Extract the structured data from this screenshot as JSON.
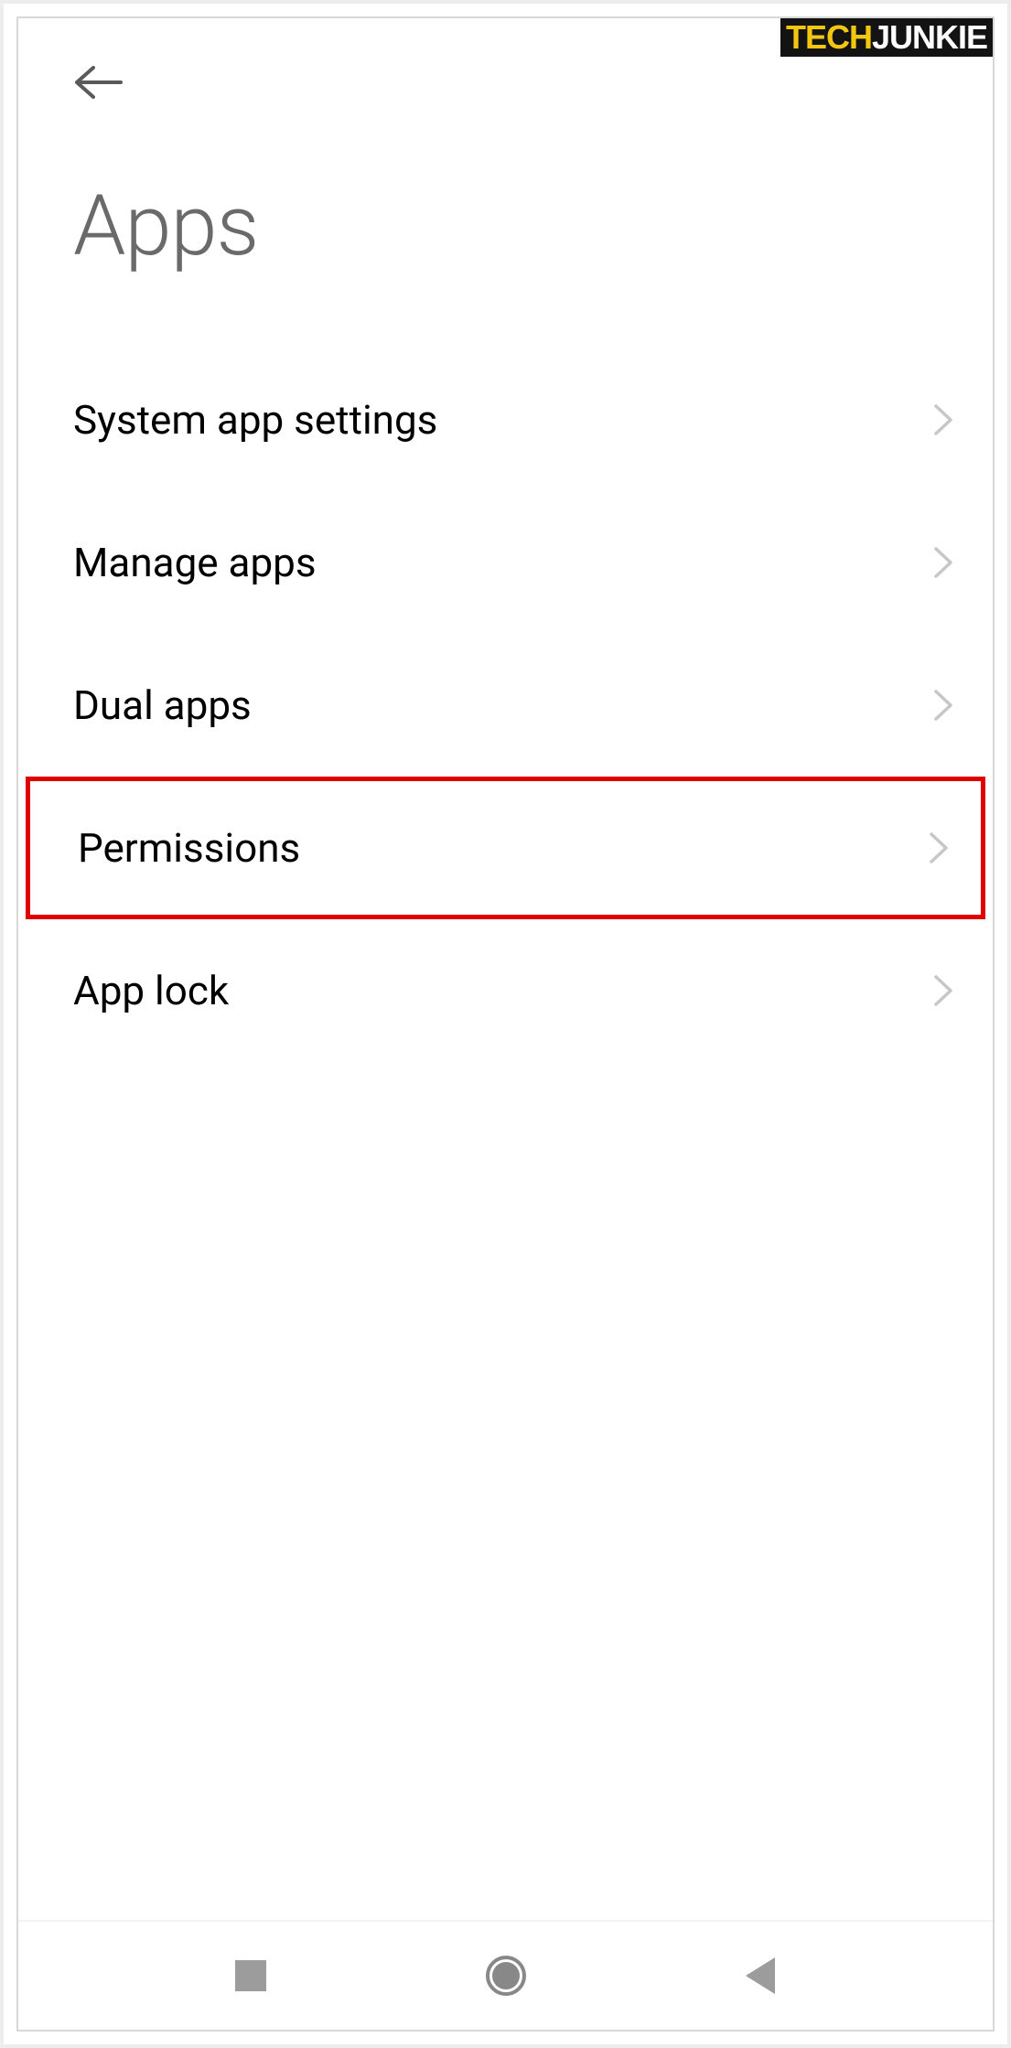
{
  "watermark": {
    "part1": "TECH",
    "part2": "JUNKIE"
  },
  "header": {
    "title": "Apps"
  },
  "settings": {
    "items": [
      {
        "label": "System app settings",
        "highlighted": false
      },
      {
        "label": "Manage apps",
        "highlighted": false
      },
      {
        "label": "Dual apps",
        "highlighted": false
      },
      {
        "label": "Permissions",
        "highlighted": true
      },
      {
        "label": "App lock",
        "highlighted": false
      }
    ]
  },
  "colors": {
    "highlight": "#e00000"
  }
}
